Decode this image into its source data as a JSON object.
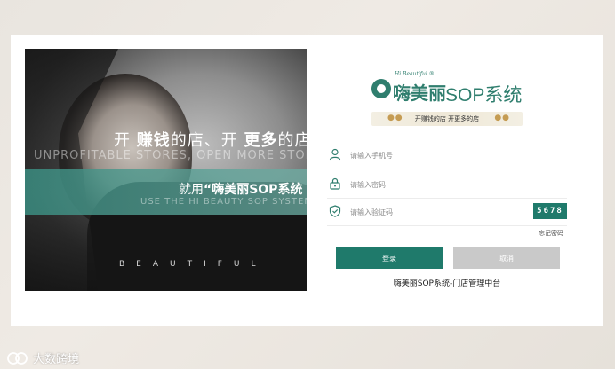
{
  "hero": {
    "slogan_part1": "开 ",
    "slogan_bold1": "赚钱",
    "slogan_part2": "的店、开 ",
    "slogan_bold2": "更多",
    "slogan_part3": "的店",
    "slogan_en": "UNPROFITABLE STORES, OPEN MORE STORES",
    "banner_prefix": "就用",
    "banner_bold": "“嗨美丽SOP系统 ”",
    "banner_en": "USE THE HI BEAUTY SOP SYSTEM",
    "beautiful": "BEAUTIFUL"
  },
  "logo": {
    "small_text": "Hi Beautiful ®",
    "cn_text": "嗨美丽",
    "sop_text": "SOP系统",
    "brand_color": "#2f7e6e"
  },
  "tagline": {
    "dots_left": "●  ●",
    "text": "开赚钱的店  开更多的店",
    "dots_right": "●  ●"
  },
  "form": {
    "phone_placeholder": "请输入手机号",
    "password_placeholder": "请输入密码",
    "code_placeholder": "请输入验证码",
    "captcha_value": "5678",
    "forgot_label": "忘记密码",
    "login_label": "登录",
    "cancel_label": "取消",
    "footer_title": "嗨美丽SOP系统-门店管理中台"
  },
  "watermark": {
    "text": "大数跨境"
  },
  "colors": {
    "accent": "#1f7a6b",
    "cancel": "#c9c9c9"
  }
}
